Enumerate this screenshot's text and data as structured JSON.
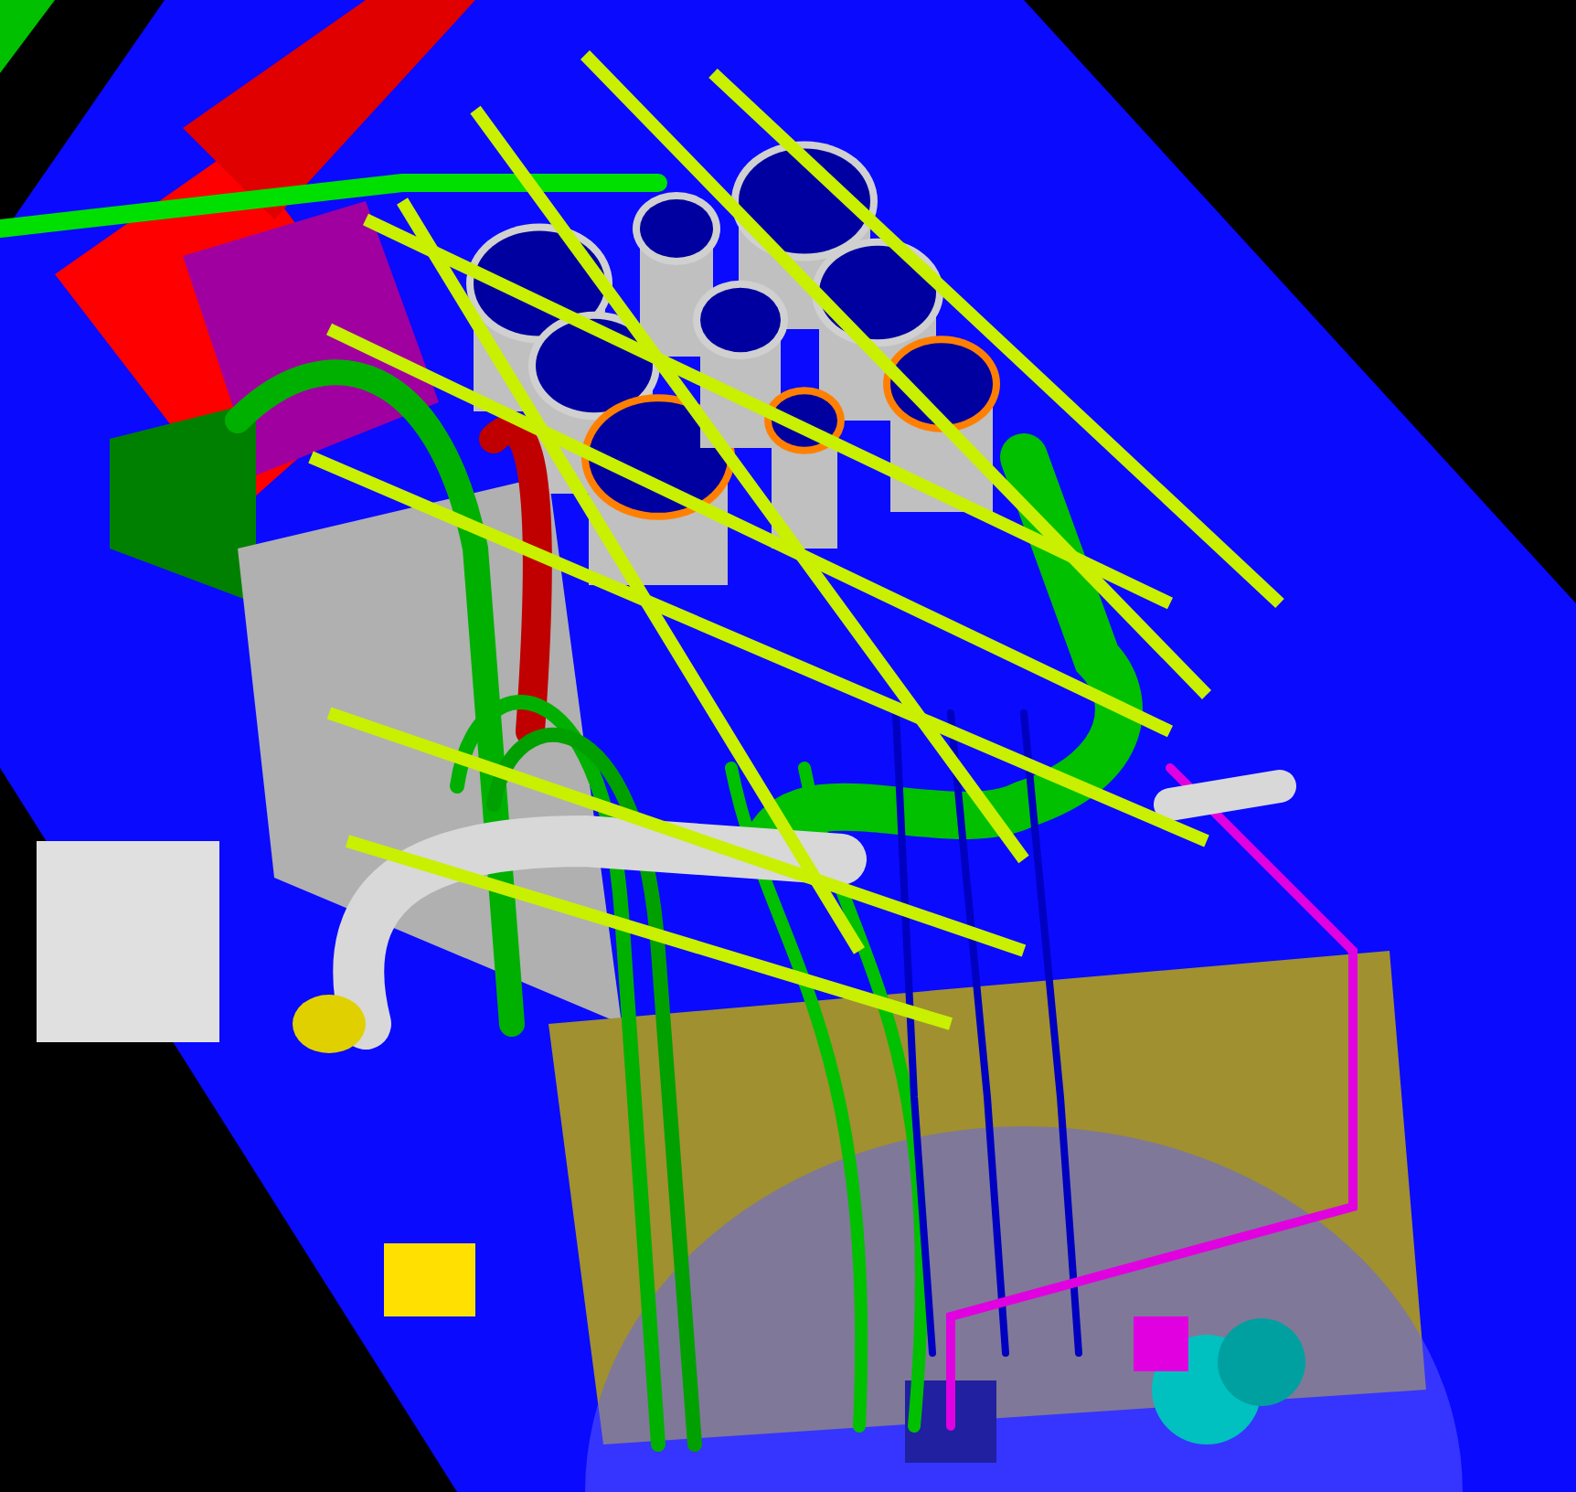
{
  "model_view": {
    "kind": "render"
  }
}
